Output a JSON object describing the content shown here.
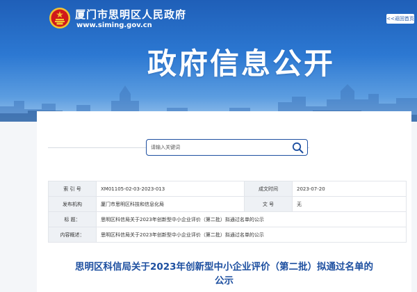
{
  "header": {
    "site_name": "厦门市思明区人民政府",
    "site_url": "www.siming.gov.cn",
    "back_button": "<<返回首页",
    "page_heading": "政府信息公开"
  },
  "search": {
    "placeholder": "请输入关键词"
  },
  "info_table": {
    "index_label": "索 引 号",
    "index_value": "XM01105-02-03-2023-013",
    "date_label": "成文时间",
    "date_value": "2023-07-20",
    "publisher_label": "发布机构",
    "publisher_value": "厦门市思明区科技和信息化局",
    "doc_no_label": "文 号",
    "doc_no_value": "无",
    "title_label": "标 题：",
    "title_value": "思明区科信局关于2023年创新型中小企业评价（第二批）拟通过名单的公示",
    "summary_label": "内容概述：",
    "summary_value": "思明区科信局关于2023年创新型中小企业评价（第二批）拟通过名单的公示"
  },
  "article": {
    "title_line1": "思明区科信局关于2023年创新型中小企业评价（第二批）拟通过名单的",
    "title_line2": "公示"
  },
  "colors": {
    "brand_blue": "#1d4fa0",
    "banner_top": "#1f5fb8",
    "emblem_red": "#d0191b",
    "emblem_gold": "#f2c431"
  }
}
